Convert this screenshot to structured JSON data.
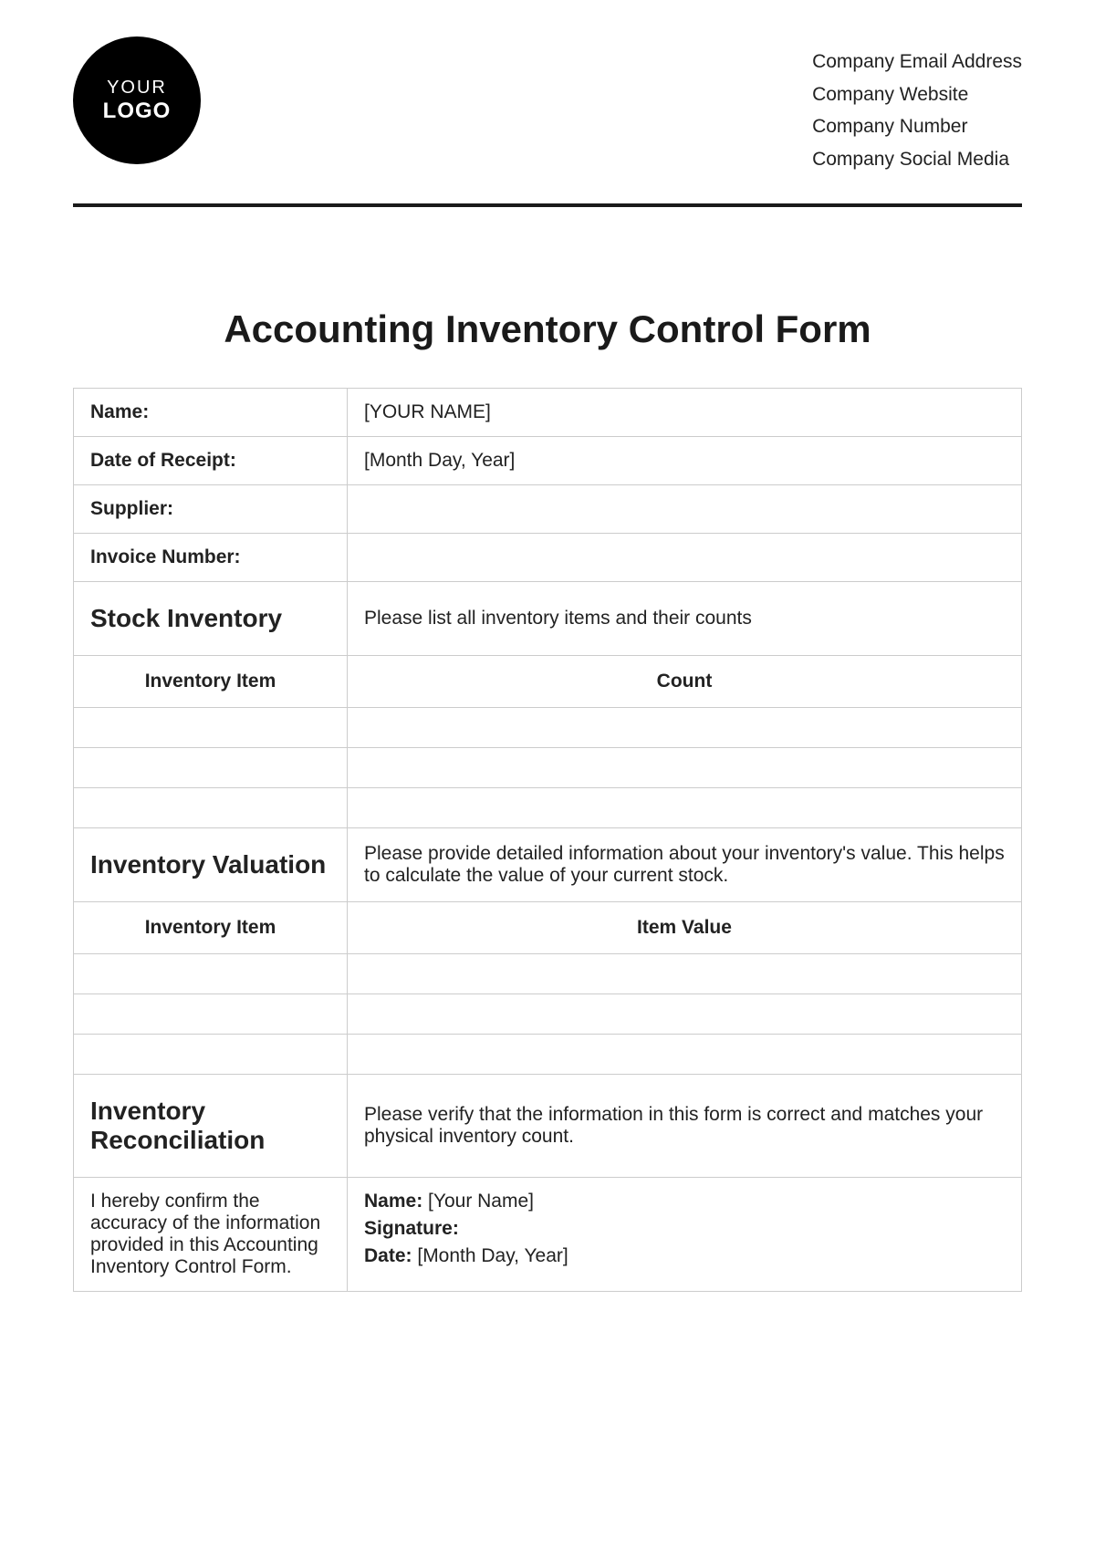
{
  "header": {
    "logo": {
      "line1": "YOUR",
      "line2": "LOGO"
    },
    "company_info": [
      "Company Email Address",
      "Company Website",
      "Company Number",
      "Company Social Media"
    ]
  },
  "title": "Accounting Inventory Control Form",
  "fields": {
    "name": {
      "label": "Name:",
      "value": "[YOUR NAME]"
    },
    "date_of_receipt": {
      "label": "Date of Receipt:",
      "value": "[Month Day, Year]"
    },
    "supplier": {
      "label": "Supplier:",
      "value": ""
    },
    "invoice_number": {
      "label": "Invoice Number:",
      "value": ""
    }
  },
  "sections": {
    "stock_inventory": {
      "heading": "Stock Inventory",
      "description": "Please list all inventory items and their counts",
      "col1": "Inventory Item",
      "col2": "Count"
    },
    "inventory_valuation": {
      "heading": "Inventory Valuation",
      "description": "Please provide detailed information about your inventory's value. This helps to calculate the value of your current stock.",
      "col1": "Inventory Item",
      "col2": "Item Value"
    },
    "inventory_reconciliation": {
      "heading": "Inventory Reconciliation",
      "description": "Please verify that the information in this form is correct and matches your physical inventory count."
    }
  },
  "confirmation": {
    "text": "I hereby confirm the accuracy of the information provided in this Accounting Inventory Control Form.",
    "name_label": "Name:",
    "name_value": "[Your Name]",
    "signature_label": "Signature:",
    "signature_value": "",
    "date_label": "Date:",
    "date_value": "[Month Day, Year]"
  }
}
